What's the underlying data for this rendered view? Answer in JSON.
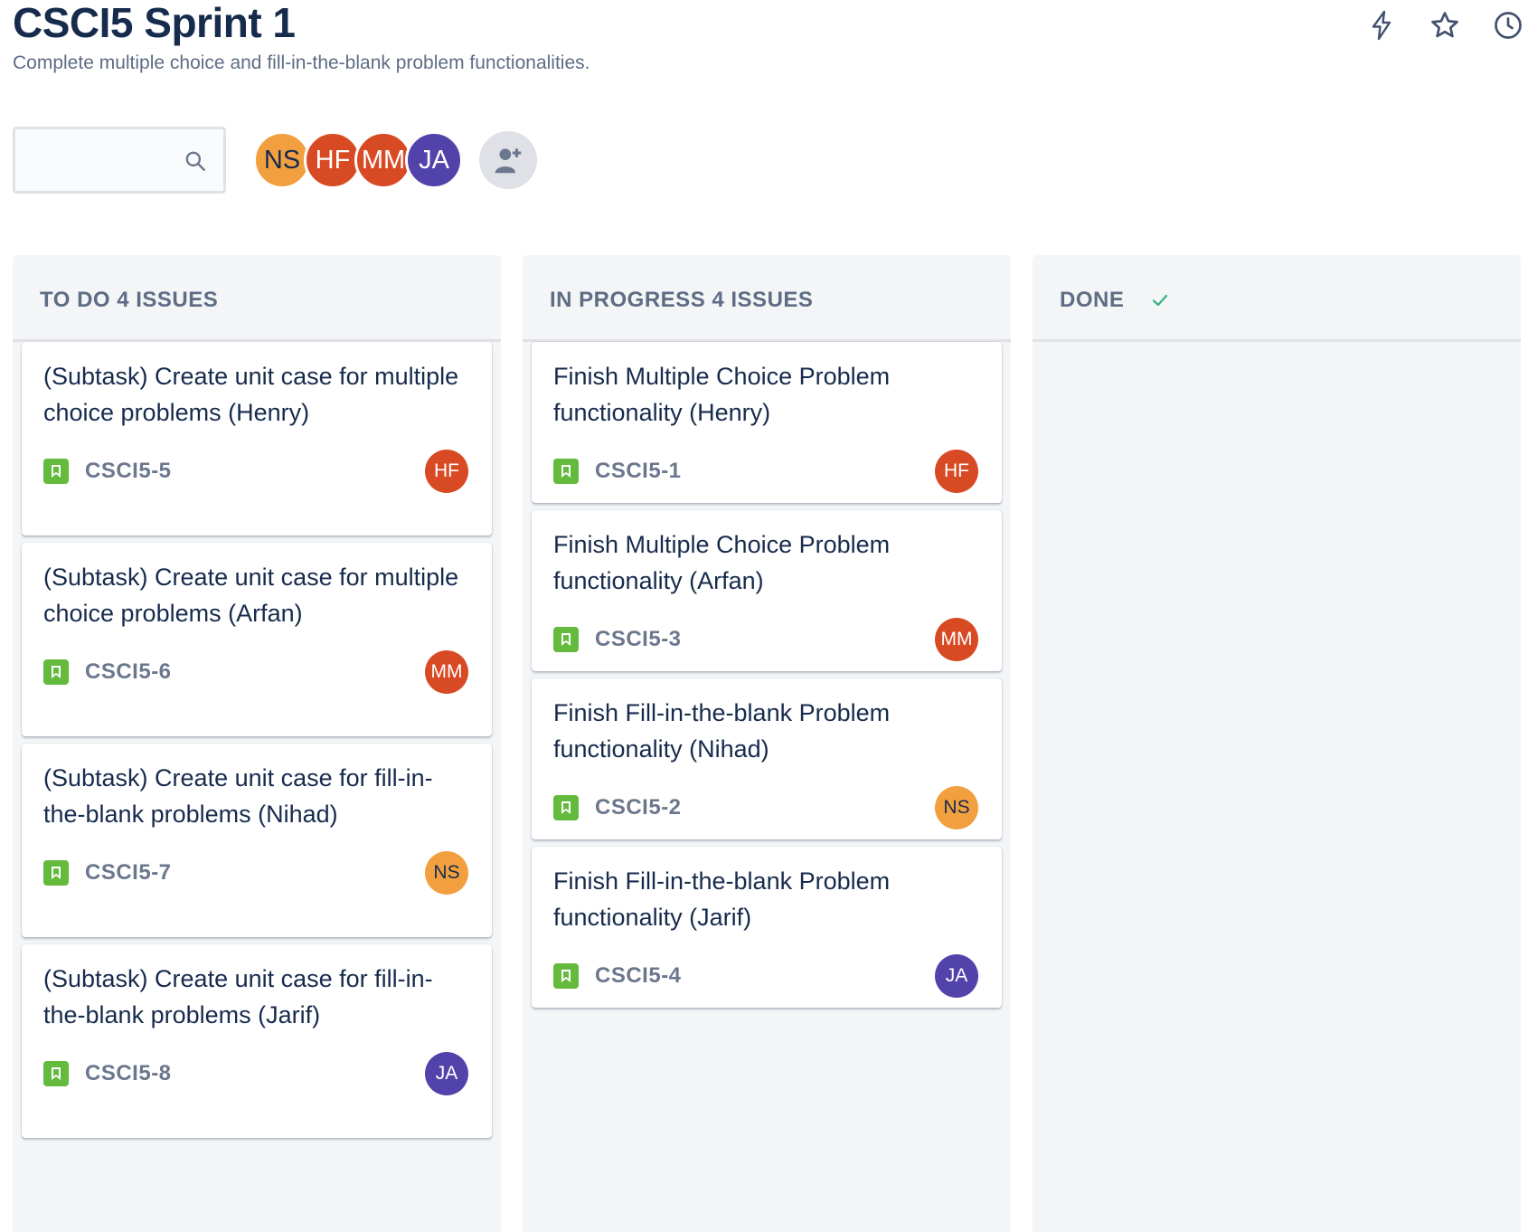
{
  "board": {
    "title": "CSCI5 Sprint 1",
    "subtitle": "Complete multiple choice and fill-in-the-blank problem functionalities."
  },
  "top_icons": [
    "lightning-icon",
    "star-icon",
    "clock-icon"
  ],
  "search": {
    "value": "",
    "placeholder": ""
  },
  "members": [
    {
      "initials": "NS",
      "color": "#f2a03f"
    },
    {
      "initials": "HF",
      "color": "#d84a24"
    },
    {
      "initials": "MM",
      "color": "#d84a24"
    },
    {
      "initials": "JA",
      "color": "#5243aa"
    }
  ],
  "columns": {
    "todo": {
      "header": "TO DO 4 ISSUES",
      "cards": [
        {
          "title": "(Subtask) Create unit case for multiple choice problems (Henry)",
          "key": "CSCI5-5",
          "assignee": "HF"
        },
        {
          "title": "(Subtask) Create unit case for multiple choice problems (Arfan)",
          "key": "CSCI5-6",
          "assignee": "MM"
        },
        {
          "title": "(Subtask) Create unit case for fill-in-the-blank problems (Nihad)",
          "key": "CSCI5-7",
          "assignee": "NS"
        },
        {
          "title": "(Subtask) Create unit case for fill-in-the-blank problems (Jarif)",
          "key": "CSCI5-8",
          "assignee": "JA"
        }
      ]
    },
    "in_progress": {
      "header": "IN PROGRESS 4 ISSUES",
      "cards": [
        {
          "title": "Finish Multiple Choice Problem functionality (Henry)",
          "key": "CSCI5-1",
          "assignee": "HF"
        },
        {
          "title": "Finish Multiple Choice Problem functionality (Arfan)",
          "key": "CSCI5-3",
          "assignee": "MM"
        },
        {
          "title": "Finish Fill-in-the-blank Problem functionality (Nihad)",
          "key": "CSCI5-2",
          "assignee": "NS"
        },
        {
          "title": "Finish Fill-in-the-blank Problem functionality (Jarif)",
          "key": "CSCI5-4",
          "assignee": "JA"
        }
      ]
    },
    "done": {
      "header": "DONE",
      "cards": []
    }
  },
  "colors": {
    "story": "#63ba3c",
    "check": "#36b37e"
  }
}
